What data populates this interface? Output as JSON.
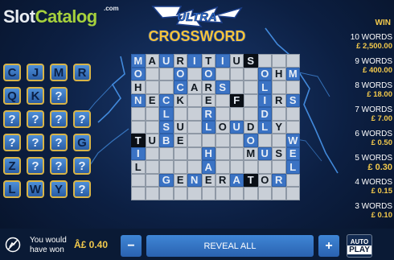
{
  "logo": {
    "slot": "Slot",
    "catalog": "Catalog",
    "dotcom": ".com"
  },
  "title": {
    "line1": "ULTRA",
    "line2": "CROSSWORD"
  },
  "letters": [
    [
      "C",
      "J",
      "M",
      "R"
    ],
    [
      "Q",
      "K",
      "?"
    ],
    [
      "?",
      "?",
      "?",
      "?"
    ],
    [
      "?",
      "?",
      "?",
      "G"
    ],
    [
      "Z",
      "?",
      "?",
      "?"
    ],
    [
      "L",
      "W",
      "Y",
      "?"
    ]
  ],
  "grid": [
    [
      {
        "t": "M",
        "s": "blue"
      },
      {
        "t": "A",
        "s": "light"
      },
      {
        "t": "U",
        "s": "blue"
      },
      {
        "t": "R",
        "s": "light"
      },
      {
        "t": "I",
        "s": "blue"
      },
      {
        "t": "T",
        "s": "light"
      },
      {
        "t": "I",
        "s": "blue"
      },
      {
        "t": "U",
        "s": "light"
      },
      {
        "t": "S",
        "s": "dark"
      },
      {
        "t": "",
        "s": "light"
      },
      {
        "t": "",
        "s": "light"
      },
      {
        "t": "",
        "s": "light"
      }
    ],
    [
      {
        "t": "O",
        "s": "blue"
      },
      {
        "t": "",
        "s": "light"
      },
      {
        "t": "",
        "s": "light"
      },
      {
        "t": "O",
        "s": "blue"
      },
      {
        "t": "",
        "s": "light"
      },
      {
        "t": "O",
        "s": "blue"
      },
      {
        "t": "",
        "s": "light"
      },
      {
        "t": "",
        "s": "light"
      },
      {
        "t": "",
        "s": "light"
      },
      {
        "t": "O",
        "s": "blue"
      },
      {
        "t": "H",
        "s": "light"
      },
      {
        "t": "M",
        "s": "blue"
      }
    ],
    [
      {
        "t": "H",
        "s": "light"
      },
      {
        "t": "",
        "s": "light"
      },
      {
        "t": "",
        "s": "light"
      },
      {
        "t": "C",
        "s": "blue"
      },
      {
        "t": "A",
        "s": "light"
      },
      {
        "t": "R",
        "s": "light"
      },
      {
        "t": "S",
        "s": "blue"
      },
      {
        "t": "",
        "s": "light"
      },
      {
        "t": "",
        "s": "light"
      },
      {
        "t": "L",
        "s": "blue"
      },
      {
        "t": "",
        "s": "light"
      },
      {
        "t": "",
        "s": "light"
      }
    ],
    [
      {
        "t": "N",
        "s": "blue"
      },
      {
        "t": "E",
        "s": "light"
      },
      {
        "t": "C",
        "s": "blue"
      },
      {
        "t": "K",
        "s": "light"
      },
      {
        "t": "",
        "s": "light"
      },
      {
        "t": "E",
        "s": "light"
      },
      {
        "t": "",
        "s": "light"
      },
      {
        "t": "F",
        "s": "dark"
      },
      {
        "t": "",
        "s": "light"
      },
      {
        "t": "I",
        "s": "blue"
      },
      {
        "t": "R",
        "s": "light"
      },
      {
        "t": "S",
        "s": "blue"
      }
    ],
    [
      {
        "t": "",
        "s": "light"
      },
      {
        "t": "",
        "s": "light"
      },
      {
        "t": "L",
        "s": "blue"
      },
      {
        "t": "",
        "s": "light"
      },
      {
        "t": "",
        "s": "light"
      },
      {
        "t": "R",
        "s": "blue"
      },
      {
        "t": "",
        "s": "light"
      },
      {
        "t": "",
        "s": "light"
      },
      {
        "t": "",
        "s": "light"
      },
      {
        "t": "D",
        "s": "blue"
      },
      {
        "t": "",
        "s": "light"
      },
      {
        "t": "",
        "s": "light"
      }
    ],
    [
      {
        "t": "",
        "s": "light"
      },
      {
        "t": "",
        "s": "light"
      },
      {
        "t": "S",
        "s": "blue"
      },
      {
        "t": "U",
        "s": "light"
      },
      {
        "t": "",
        "s": "light"
      },
      {
        "t": "L",
        "s": "blue"
      },
      {
        "t": "O",
        "s": "light"
      },
      {
        "t": "U",
        "s": "blue"
      },
      {
        "t": "D",
        "s": "light"
      },
      {
        "t": "L",
        "s": "blue"
      },
      {
        "t": "Y",
        "s": "light"
      },
      {
        "t": "",
        "s": "light"
      }
    ],
    [
      {
        "t": "T",
        "s": "dark"
      },
      {
        "t": "U",
        "s": "light"
      },
      {
        "t": "B",
        "s": "blue"
      },
      {
        "t": "E",
        "s": "light"
      },
      {
        "t": "",
        "s": "light"
      },
      {
        "t": "",
        "s": "light"
      },
      {
        "t": "",
        "s": "light"
      },
      {
        "t": "",
        "s": "light"
      },
      {
        "t": "O",
        "s": "blue"
      },
      {
        "t": "",
        "s": "light"
      },
      {
        "t": "",
        "s": "light"
      },
      {
        "t": "W",
        "s": "blue"
      }
    ],
    [
      {
        "t": "I",
        "s": "blue"
      },
      {
        "t": "",
        "s": "light"
      },
      {
        "t": "",
        "s": "light"
      },
      {
        "t": "",
        "s": "light"
      },
      {
        "t": "",
        "s": "light"
      },
      {
        "t": "H",
        "s": "blue"
      },
      {
        "t": "",
        "s": "light"
      },
      {
        "t": "",
        "s": "light"
      },
      {
        "t": "M",
        "s": "light"
      },
      {
        "t": "U",
        "s": "blue"
      },
      {
        "t": "S",
        "s": "light"
      },
      {
        "t": "E",
        "s": "blue"
      }
    ],
    [
      {
        "t": "L",
        "s": "light"
      },
      {
        "t": "",
        "s": "light"
      },
      {
        "t": "",
        "s": "light"
      },
      {
        "t": "",
        "s": "light"
      },
      {
        "t": "",
        "s": "light"
      },
      {
        "t": "A",
        "s": "blue"
      },
      {
        "t": "",
        "s": "light"
      },
      {
        "t": "",
        "s": "light"
      },
      {
        "t": "",
        "s": "light"
      },
      {
        "t": "",
        "s": "light"
      },
      {
        "t": "",
        "s": "light"
      },
      {
        "t": "L",
        "s": "blue"
      }
    ],
    [
      {
        "t": "",
        "s": "light"
      },
      {
        "t": "",
        "s": "light"
      },
      {
        "t": "G",
        "s": "blue"
      },
      {
        "t": "E",
        "s": "light"
      },
      {
        "t": "N",
        "s": "blue"
      },
      {
        "t": "E",
        "s": "light"
      },
      {
        "t": "R",
        "s": "light"
      },
      {
        "t": "A",
        "s": "blue"
      },
      {
        "t": "T",
        "s": "dark"
      },
      {
        "t": "O",
        "s": "light"
      },
      {
        "t": "R",
        "s": "blue"
      },
      {
        "t": "",
        "s": "light"
      }
    ],
    [
      {
        "t": "",
        "s": "light"
      },
      {
        "t": "",
        "s": "light"
      },
      {
        "t": "",
        "s": "light"
      },
      {
        "t": "",
        "s": "light"
      },
      {
        "t": "",
        "s": "light"
      },
      {
        "t": "",
        "s": "light"
      },
      {
        "t": "",
        "s": "light"
      },
      {
        "t": "",
        "s": "light"
      },
      {
        "t": "",
        "s": "light"
      },
      {
        "t": "",
        "s": "light"
      },
      {
        "t": "",
        "s": "light"
      },
      {
        "t": "",
        "s": "light"
      }
    ]
  ],
  "win_table": {
    "header": "WIN",
    "rows": [
      {
        "words": "10 WORDS",
        "amount": "£ 2,500.00"
      },
      {
        "words": "9 WORDS",
        "amount": "£ 400.00"
      },
      {
        "words": "8 WORDS",
        "amount": "£ 18.00"
      },
      {
        "words": "7 WORDS",
        "amount": "£ 7.00"
      },
      {
        "words": "6 WORDS",
        "amount": "£ 0.50"
      },
      {
        "words": "5 WORDS",
        "amount": "£ 0.30"
      },
      {
        "words": "4 WORDS",
        "amount": "£ 0.15"
      },
      {
        "words": "3 WORDS",
        "amount": "£ 0.10"
      }
    ]
  },
  "bottom": {
    "you_would_line1": "You would",
    "you_would_line2": "have won",
    "won_amount": "Â£ 0.40",
    "minus": "−",
    "reveal_all": "REVEAL ALL",
    "plus": "+",
    "auto": "AUTO",
    "play": "PLAY"
  },
  "colors": {
    "accent": "#f2c94c",
    "button": "#3170c2",
    "tile_blue": "#3b73c4"
  }
}
